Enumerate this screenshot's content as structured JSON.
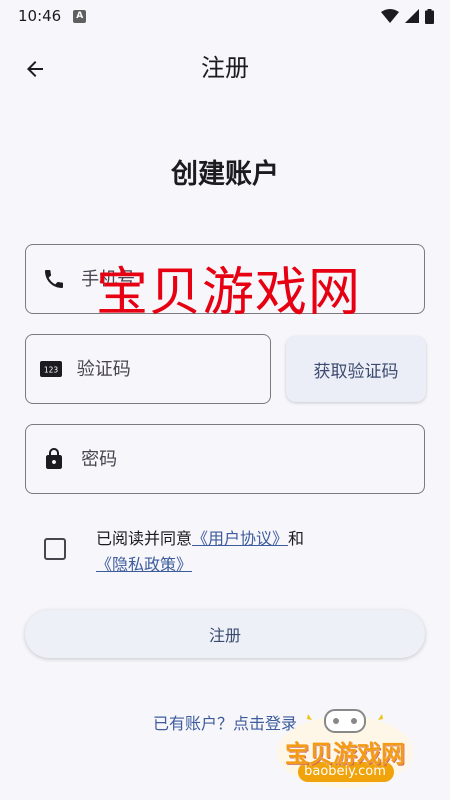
{
  "status_bar": {
    "time": "10:46",
    "notification_letter": "A"
  },
  "app_bar": {
    "title": "注册"
  },
  "page_title": "创建账户",
  "phone": {
    "placeholder": "手机号"
  },
  "code": {
    "placeholder": "验证码",
    "icon_text": "123",
    "get_code_label": "获取验证码"
  },
  "password": {
    "placeholder": "密码"
  },
  "agreement": {
    "prefix": "已阅读并同意",
    "user_agreement": "《用户协议》",
    "and": "和",
    "privacy_policy": "《隐私政策》"
  },
  "register_button": "注册",
  "login_link": "已有账户？点击登录",
  "watermark": {
    "text": "宝贝游戏网",
    "url": "baobeiy.com"
  },
  "colors": {
    "accent": "#3e5c9c",
    "background": "#f6f6fb",
    "watermark": "#e60012"
  }
}
